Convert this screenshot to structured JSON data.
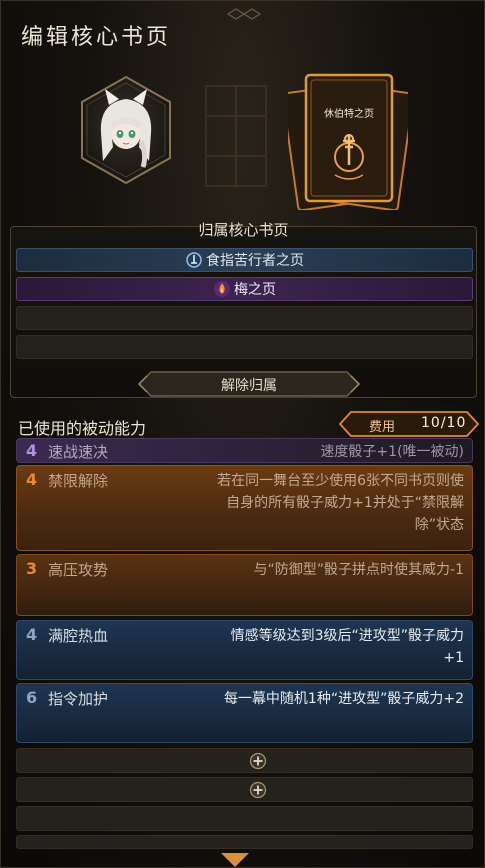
{
  "header": {
    "title": "编辑核心书页"
  },
  "character": {
    "portrait_icon": "character-portrait"
  },
  "core_page": {
    "name": "休伯特之页",
    "icon": "key-emblem-icon"
  },
  "belong": {
    "title": "归属核心书页",
    "slots": [
      {
        "label": "食指苦行者之页",
        "color": "blue",
        "icon": "index-finger-icon"
      },
      {
        "label": "梅之页",
        "color": "purple",
        "icon": "flame-icon"
      },
      {
        "label": "",
        "color": "empty"
      },
      {
        "label": "",
        "color": "empty"
      }
    ],
    "dissolve_label": "解除归属"
  },
  "passives": {
    "header": "已使用的被动能力",
    "cost_label": "费用",
    "cost_value": "10/10",
    "items": [
      {
        "cost": "4",
        "name": "速战速决",
        "desc": "速度骰子+1(唯一被动)",
        "color": "purple"
      },
      {
        "cost": "4",
        "name": "禁限解除",
        "desc": "若在同一舞台至少使用6张不同书页则使自身的所有骰子威力+1并处于“禁限解除”状态",
        "color": "orange"
      },
      {
        "cost": "3",
        "name": "高压攻势",
        "desc": "与“防御型”骰子拼点时使其威力-1",
        "color": "orange"
      },
      {
        "cost": "4",
        "name": "满腔热血",
        "desc": "情感等级达到3级后“进攻型”骰子威力+1",
        "color": "blue"
      },
      {
        "cost": "6",
        "name": "指令加护",
        "desc": "每一幕中随机1种“进攻型”骰子威力+2",
        "color": "blue"
      }
    ],
    "empty_slots": [
      {
        "has_add": true
      },
      {
        "has_add": true
      },
      {
        "has_add": false
      },
      {
        "has_add": false
      }
    ]
  },
  "colors": {
    "accent_orange": "#e8893a",
    "accent_blue": "#2c3f56",
    "accent_purple": "#3d2450",
    "gold": "#d7913a"
  }
}
